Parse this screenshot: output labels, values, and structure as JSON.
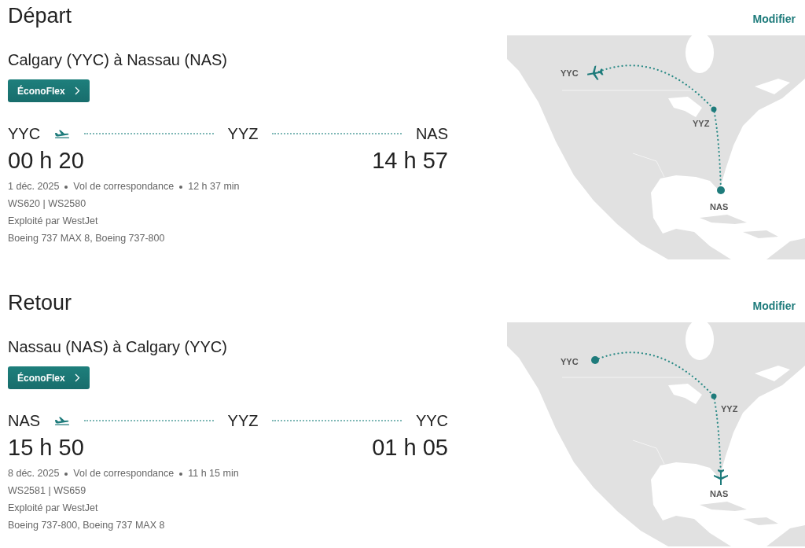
{
  "sections": [
    {
      "title": "Départ",
      "edit_link": "Modifier",
      "route": "Calgary (YYC) à Nassau (NAS)",
      "fare_button": "ÉconoFlex",
      "origin": "YYC",
      "connection": "YYZ",
      "destination": "NAS",
      "departure_time": "00 h 20",
      "arrival_time": "14 h 57",
      "date": "1 déc. 2025",
      "flight_type": "Vol de correspondance",
      "duration": "12 h 37 min",
      "flight_numbers": "WS620 | WS2580",
      "operator": "Exploité par WestJet",
      "aircraft": "Boeing 737 MAX 8, Boeing 737-800",
      "map": {
        "stops": [
          {
            "label": "YYC",
            "plane": true
          },
          {
            "label": "YYZ",
            "plane": false
          },
          {
            "label": "NAS",
            "plane": false
          }
        ]
      }
    },
    {
      "title": "Retour",
      "edit_link": "Modifier",
      "route": "Nassau (NAS) à Calgary (YYC)",
      "fare_button": "ÉconoFlex",
      "origin": "NAS",
      "connection": "YYZ",
      "destination": "YYC",
      "departure_time": "15 h 50",
      "arrival_time": "01 h 05",
      "date": "8 déc. 2025",
      "flight_type": "Vol de correspondance",
      "duration": "11 h 15 min",
      "flight_numbers": "WS2581 | WS659",
      "operator": "Exploité par WestJet",
      "aircraft": "Boeing 737-800, Boeing 737 MAX 8",
      "map": {
        "stops": [
          {
            "label": "YYC",
            "plane": false
          },
          {
            "label": "YYZ",
            "plane": false
          },
          {
            "label": "NAS",
            "plane": true
          }
        ]
      }
    }
  ]
}
